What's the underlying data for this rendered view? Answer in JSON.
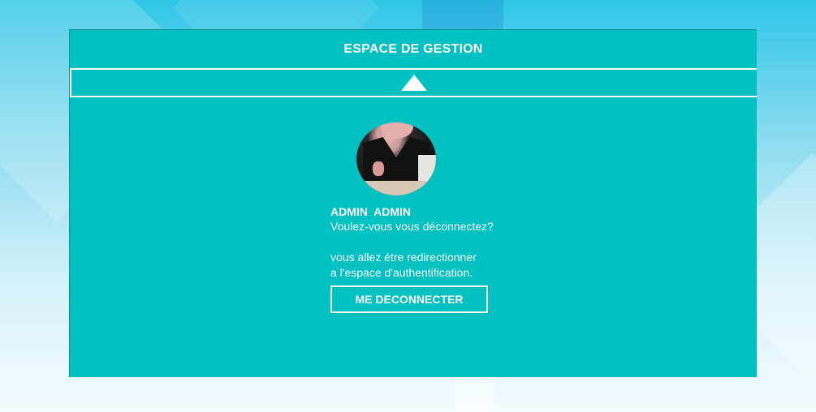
{
  "header": {
    "title": "ESPACE DE GESTION"
  },
  "collapse": {
    "icon": "chevron-up-icon"
  },
  "profile": {
    "name": "ADMIN  ADMIN",
    "question": "Voulez-vous vous déconnectez?",
    "info_line1": "vous allez étre redirectionner",
    "info_line2": "a l'espace d'authentification.",
    "logout_label": "ME DECONNECTER"
  },
  "colors": {
    "panel": "#00c1c1",
    "text": "#ffffff"
  }
}
